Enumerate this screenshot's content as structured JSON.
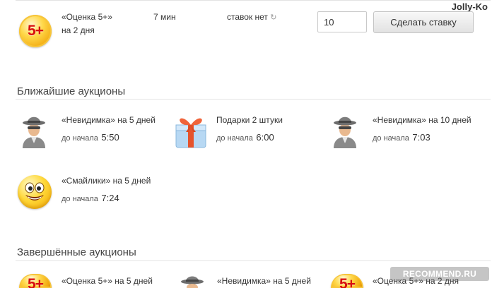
{
  "watermark_top": "Jolly-Ko",
  "current_auction": {
    "badge": "5+",
    "name": "«Оценка 5+»",
    "duration": "на 2 дня",
    "time_left": "7 мин",
    "bids": "ставок нет",
    "bid_value": "10",
    "bid_button": "Сделать ставку"
  },
  "upcoming": {
    "title": "Ближайшие аукционы",
    "items": [
      {
        "icon": "spy-icon",
        "name": "«Невидимка» на 5 дней",
        "start_label": "до начала",
        "start_time": "5:50"
      },
      {
        "icon": "gift-icon",
        "name": "Подарки 2 штуки",
        "start_label": "до начала",
        "start_time": "6:00"
      },
      {
        "icon": "spy-icon",
        "name": "«Невидимка» на 10 дней",
        "start_label": "до начала",
        "start_time": "7:03"
      },
      {
        "icon": "smiley-icon",
        "name": "«Смайлики» на 5 дней",
        "start_label": "до начала",
        "start_time": "7:24"
      }
    ]
  },
  "finished": {
    "title": "Завершённые аукционы",
    "items": [
      {
        "icon": "badge-5-plus-icon",
        "badge": "5+",
        "name": "«Оценка 5+» на 5 дней"
      },
      {
        "icon": "spy-icon",
        "name": "«Невидимка» на 5 дней"
      },
      {
        "icon": "badge-5-plus-icon",
        "badge": "5+",
        "name": "«Оценка 5+» на 2 дня"
      }
    ]
  },
  "watermark_bottom": "RECOMMEND.RU"
}
